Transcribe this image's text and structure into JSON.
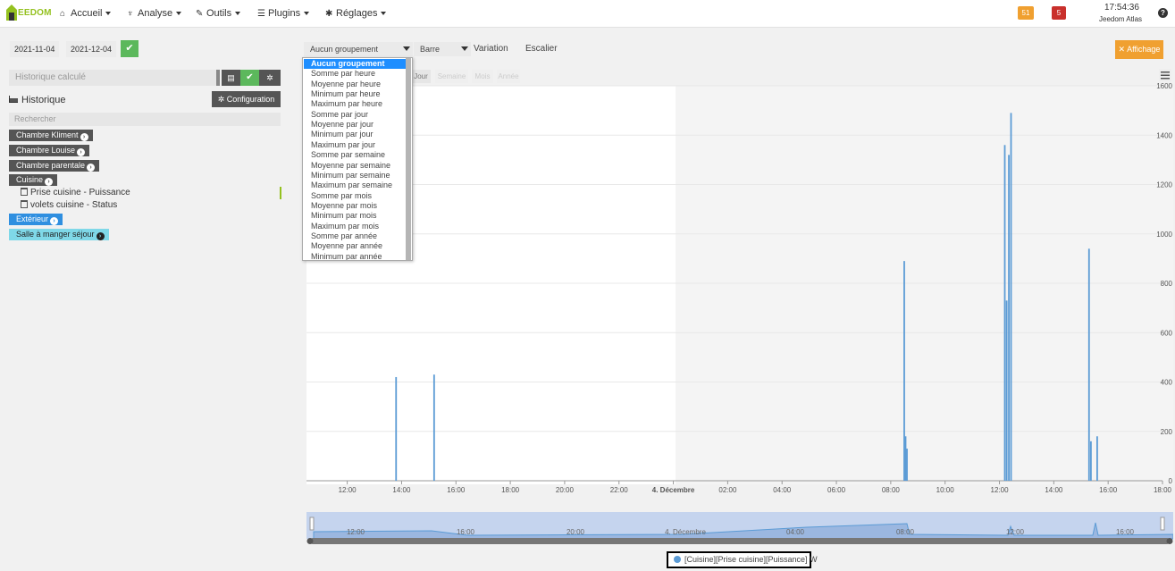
{
  "nav": {
    "logo": "EEDOM",
    "items": [
      {
        "label": "Accueil",
        "icon": "home-icon",
        "glyph": "⌂"
      },
      {
        "label": "Analyse",
        "icon": "stethoscope-icon",
        "glyph": "♆"
      },
      {
        "label": "Outils",
        "icon": "wrench-icon",
        "glyph": "✎"
      },
      {
        "label": "Plugins",
        "icon": "list-icon",
        "glyph": "☰"
      },
      {
        "label": "Réglages",
        "icon": "gears-icon",
        "glyph": "✱"
      }
    ],
    "badge_orange": "51",
    "badge_red": "5",
    "time": "17:54:36",
    "system_name": "Jeedom Atlas",
    "help": "?"
  },
  "filters": {
    "date_start": "2021-11-04",
    "date_end": "2021-12-04",
    "calc_placeholder": "Historique calculé",
    "config_label": "Configuration",
    "history_label": "Historique",
    "search_placeholder": "Rechercher"
  },
  "objects": [
    {
      "label": "Chambre Kliment"
    },
    {
      "label": "Chambre Louise"
    },
    {
      "label": "Chambre parentale"
    },
    {
      "label": "Cuisine"
    },
    {
      "label": "Extérieur"
    },
    {
      "label": "Salle à manger séjour"
    }
  ],
  "commands": [
    {
      "label": "Prise cuisine - Puissance"
    },
    {
      "label": "volets cuisine - Status"
    }
  ],
  "toolbar": {
    "grouping": "Aucun groupement",
    "type": "Barre",
    "variation": "Variation",
    "stair": "Escalier",
    "affichage": "Affichage"
  },
  "range_buttons": [
    "Jour",
    "Semaine",
    "Mois",
    "Année"
  ],
  "grouping_options": [
    "Aucun groupement",
    "Somme par heure",
    "Moyenne par heure",
    "Minimum par heure",
    "Maximum par heure",
    "Somme par jour",
    "Moyenne par jour",
    "Minimum par jour",
    "Maximum par jour",
    "Somme par semaine",
    "Moyenne par semaine",
    "Minimum par semaine",
    "Maximum par semaine",
    "Somme par mois",
    "Moyenne par mois",
    "Minimum par mois",
    "Maximum par mois",
    "Somme par année",
    "Moyenne par année",
    "Minimum par année"
  ],
  "legend": "[Cuisine][Prise cuisine][Puissance] W",
  "colors": {
    "accent": "#1e8eff",
    "series": "#5b9bd5",
    "ok": "#5cb85c",
    "warn": "#f0a030",
    "danger": "#c9302c"
  },
  "chart_data": {
    "type": "bar",
    "x_tick_labels": [
      "12:00",
      "14:00",
      "16:00",
      "18:00",
      "20:00",
      "22:00",
      "4. Décembre",
      "02:00",
      "04:00",
      "06:00",
      "08:00",
      "10:00",
      "12:00",
      "14:00",
      "16:00",
      "18:00"
    ],
    "y_tick_labels": [
      "0",
      "200",
      "400",
      "600",
      "800",
      "1000",
      "1200",
      "1400",
      "1600"
    ],
    "ylim": [
      0,
      1600
    ],
    "x_range_hours": [
      -13.5,
      18
    ],
    "series": [
      {
        "name": "[Cuisine][Prise cuisine][Puissance] W",
        "points": [
          {
            "x_hours": -10.2,
            "y": 420
          },
          {
            "x_hours": -8.8,
            "y": 430
          },
          {
            "x_hours": 8.5,
            "y": 890
          },
          {
            "x_hours": 8.55,
            "y": 180
          },
          {
            "x_hours": 8.6,
            "y": 130
          },
          {
            "x_hours": 12.2,
            "y": 1360
          },
          {
            "x_hours": 12.27,
            "y": 730
          },
          {
            "x_hours": 12.35,
            "y": 1320
          },
          {
            "x_hours": 12.43,
            "y": 1490
          },
          {
            "x_hours": 15.3,
            "y": 940
          },
          {
            "x_hours": 15.37,
            "y": 160
          },
          {
            "x_hours": 15.6,
            "y": 180
          }
        ]
      }
    ],
    "navigator_tick_labels": [
      "12:00",
      "16:00",
      "20:00",
      "4. Décembre",
      "04:00",
      "08:00",
      "12:00",
      "16:00"
    ],
    "grid": true
  }
}
